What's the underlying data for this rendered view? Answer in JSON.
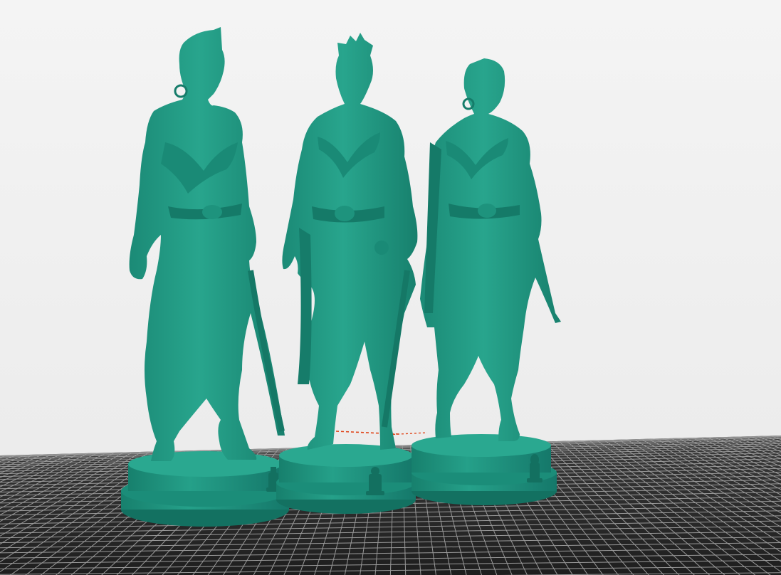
{
  "viewport": {
    "background_color": "#f0f0f0",
    "bed_color": "#2b2b2b",
    "grid_line_color": "#9a9a9a",
    "axis_color": "#e0451a"
  },
  "models": [
    {
      "name": "queen-figurine",
      "color": "#1f9a84",
      "base_emblem": "king"
    },
    {
      "name": "queen-figurine-center",
      "color": "#1f9a84",
      "base_emblem": "queen"
    },
    {
      "name": "bishop-figurine",
      "color": "#1f9a84",
      "base_emblem": "bishop"
    }
  ]
}
